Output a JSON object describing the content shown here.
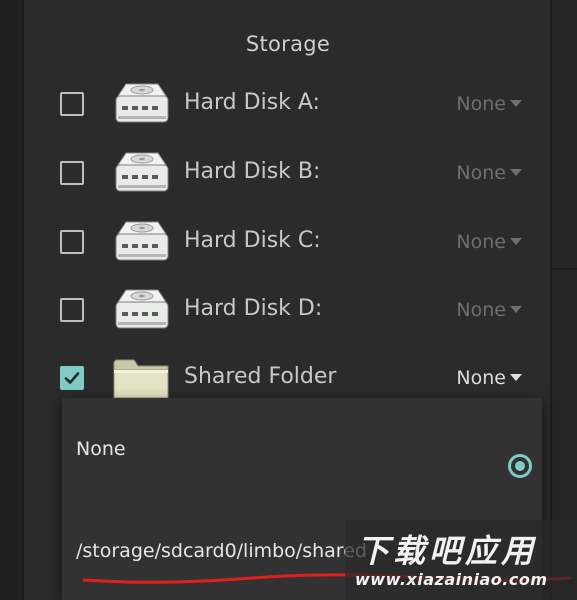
{
  "dialog": {
    "title": "Storage",
    "rows": [
      {
        "label": "Hard Disk A:",
        "value": "None",
        "checked": false,
        "icon": "hard-disk-icon"
      },
      {
        "label": "Hard Disk B:",
        "value": "None",
        "checked": false,
        "icon": "hard-disk-icon"
      },
      {
        "label": "Hard Disk C:",
        "value": "None",
        "checked": false,
        "icon": "hard-disk-icon"
      },
      {
        "label": "Hard Disk D:",
        "value": "None",
        "checked": false,
        "icon": "hard-disk-icon"
      },
      {
        "label": "Shared Folder",
        "value": "None",
        "checked": true,
        "icon": "folder-icon"
      }
    ]
  },
  "popup": {
    "options": [
      {
        "label": "None",
        "selected": true
      },
      {
        "label": "/storage/sdcard0/limbo/shared",
        "selected": false
      }
    ]
  },
  "watermark": {
    "title": "下载吧应用",
    "url": "www.xiazainiao.com"
  },
  "colors": {
    "accent": "#80cbc4",
    "background": "#2b2b2b",
    "popup": "#323232",
    "annotation": "#e0201d"
  }
}
